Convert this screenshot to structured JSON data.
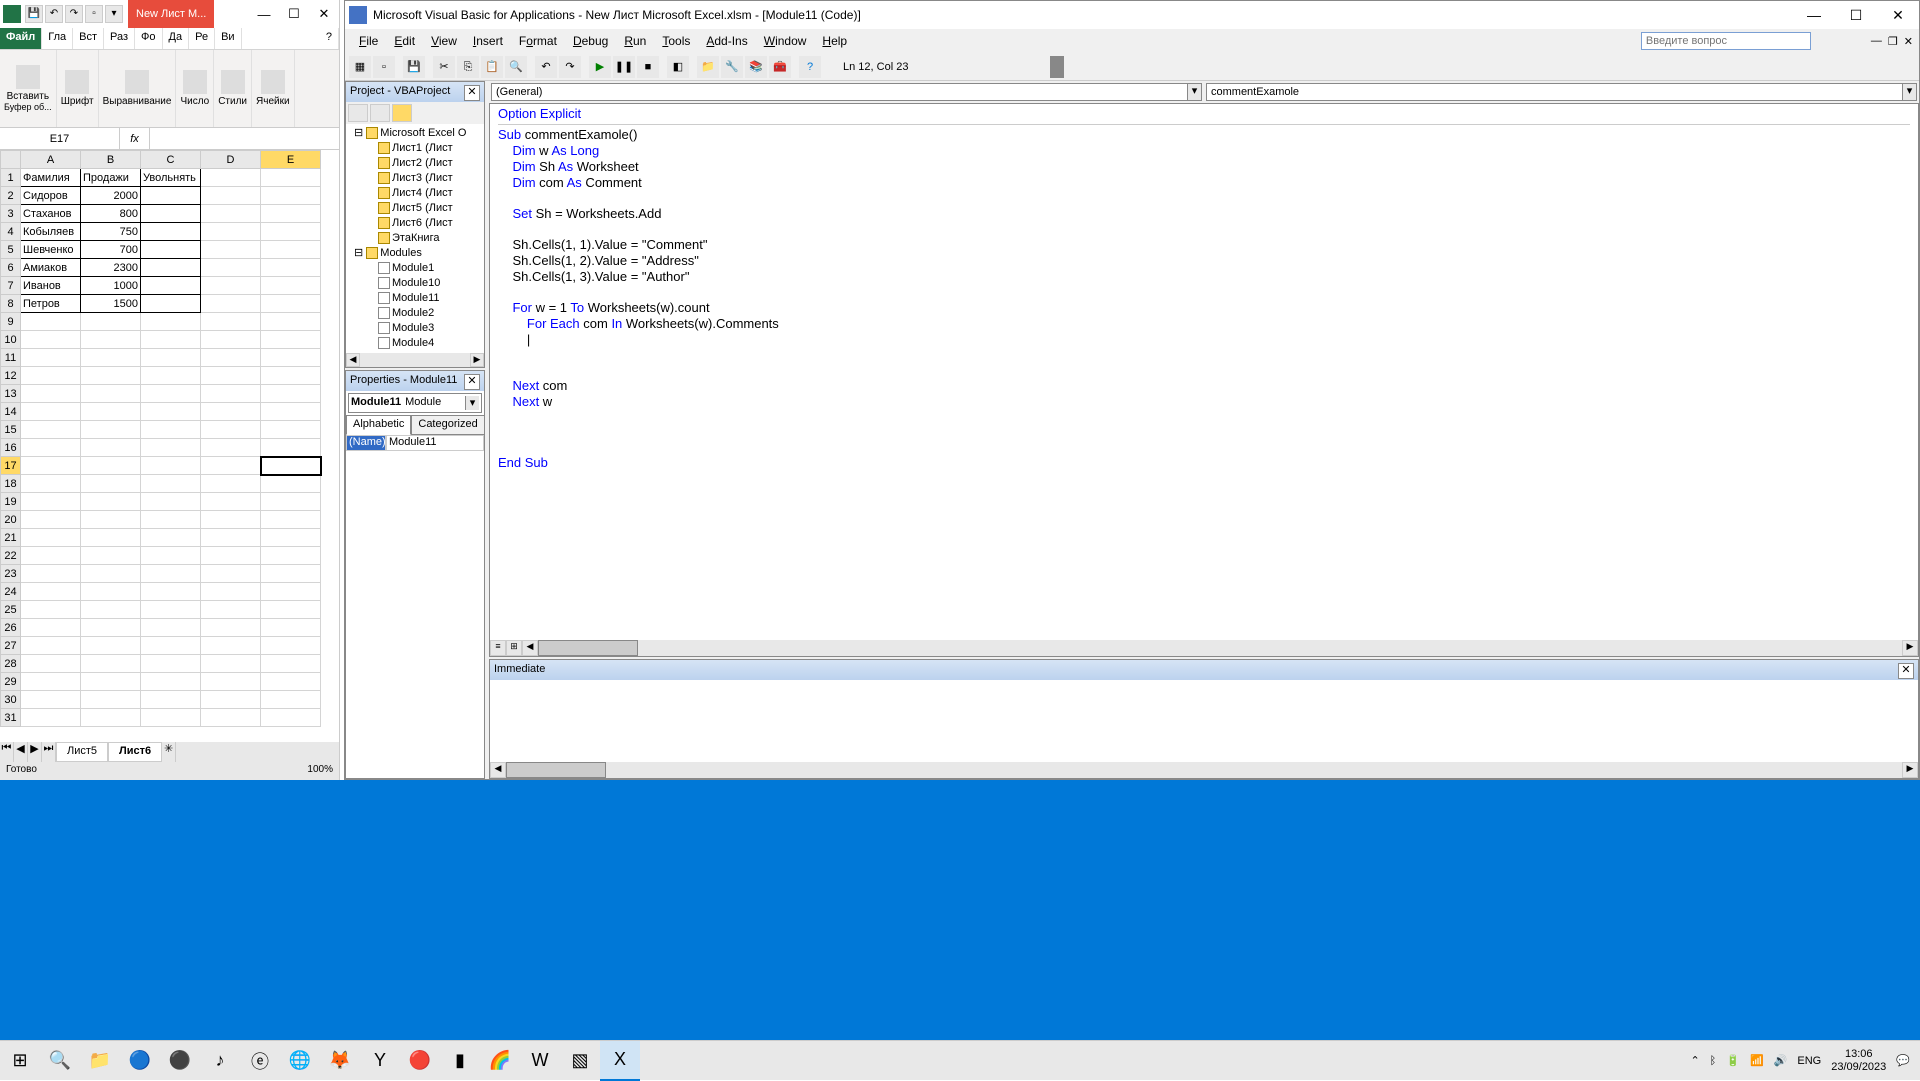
{
  "excel": {
    "titlebar": {
      "redtab": "New Лист M..."
    },
    "tabs": {
      "file": "Файл",
      "t1": "Гла",
      "t2": "Вст",
      "t3": "Раз",
      "t4": "Фо",
      "t5": "Да",
      "t6": "Ре",
      "t7": "Ви"
    },
    "ribbon": {
      "g1": "Вставить",
      "g1b": "Буфер об...",
      "g2": "Шрифт",
      "g3": "Выравнивание",
      "g4": "Число",
      "g5": "Стили",
      "g6": "Ячейки"
    },
    "namebox": "E17",
    "fx": "fx",
    "cols": [
      "A",
      "B",
      "C",
      "D",
      "E"
    ],
    "rows": [
      [
        "Фамилия",
        "Продажи",
        "Увольнять",
        "",
        ""
      ],
      [
        "Сидоров",
        "2000",
        "",
        "",
        ""
      ],
      [
        "Стаханов",
        "800",
        "",
        "",
        ""
      ],
      [
        "Кобыляев",
        "750",
        "",
        "",
        ""
      ],
      [
        "Шевченко",
        "700",
        "",
        "",
        ""
      ],
      [
        "Амиаков",
        "2300",
        "",
        "",
        ""
      ],
      [
        "Иванов",
        "1000",
        "",
        "",
        ""
      ],
      [
        "Петров",
        "1500",
        "",
        "",
        ""
      ]
    ],
    "sheets": {
      "s1": "Лист5",
      "s2": "Лист6"
    },
    "status": "Готово",
    "zoom": "100%"
  },
  "vba": {
    "title": "Microsoft Visual Basic for Applications - New Лист Microsoft Excel.xlsm - [Module11 (Code)]",
    "menu": {
      "file": "File",
      "edit": "Edit",
      "view": "View",
      "insert": "Insert",
      "format": "Format",
      "debug": "Debug",
      "run": "Run",
      "tools": "Tools",
      "addins": "Add-Ins",
      "window": "Window",
      "help": "Help"
    },
    "question_placeholder": "Введите вопрос",
    "cursor_status": "Ln 12, Col 23",
    "project": {
      "title": "Project - VBAProject",
      "root": "Microsoft Excel O",
      "sheets": [
        "Лист1 (Лист",
        "Лист2 (Лист",
        "Лист3 (Лист",
        "Лист4 (Лист",
        "Лист5 (Лист",
        "Лист6 (Лист",
        "ЭтаКнига"
      ],
      "modules_label": "Modules",
      "modules": [
        "Module1",
        "Module10",
        "Module11",
        "Module2",
        "Module3",
        "Module4"
      ]
    },
    "properties": {
      "title": "Properties - Module11",
      "combo_name": "Module11",
      "combo_type": "Module",
      "tab1": "Alphabetic",
      "tab2": "Categorized",
      "row_name": "(Name)",
      "row_val": "Module11"
    },
    "dropdowns": {
      "left": "(General)",
      "right": "commentExamole"
    },
    "code": {
      "l1": "Option Explicit",
      "l2": "Sub",
      "l2b": " commentExamole()",
      "l3": "    Dim",
      "l3b": " w ",
      "l3c": "As Long",
      "l4": "    Dim",
      "l4b": " Sh ",
      "l4c": "As",
      "l4d": " Worksheet",
      "l5": "    Dim",
      "l5b": " com ",
      "l5c": "As",
      "l5d": " Comment",
      "l6": "    Set",
      "l6b": " Sh = Worksheets.Add",
      "l7": "    Sh.Cells(1, 1).Value = \"Comment\"",
      "l8": "    Sh.Cells(1, 2).Value = \"Address\"",
      "l9": "    Sh.Cells(1, 3).Value = \"Author\"",
      "l10": "    For",
      "l10b": " w = 1 ",
      "l10c": "To",
      "l10d": " Worksheets(w).count",
      "l11": "        For Each",
      "l11b": " com ",
      "l11c": "In",
      "l11d": " Worksheets(w).Comments",
      "l12": "        |",
      "l13": "    Next",
      "l13b": " com",
      "l14": "    Next",
      "l14b": " w",
      "l15": "End Sub"
    },
    "immediate": {
      "title": "Immediate"
    }
  },
  "taskbar": {
    "lang": "ENG",
    "time": "13:06",
    "date": "23/09/2023"
  }
}
